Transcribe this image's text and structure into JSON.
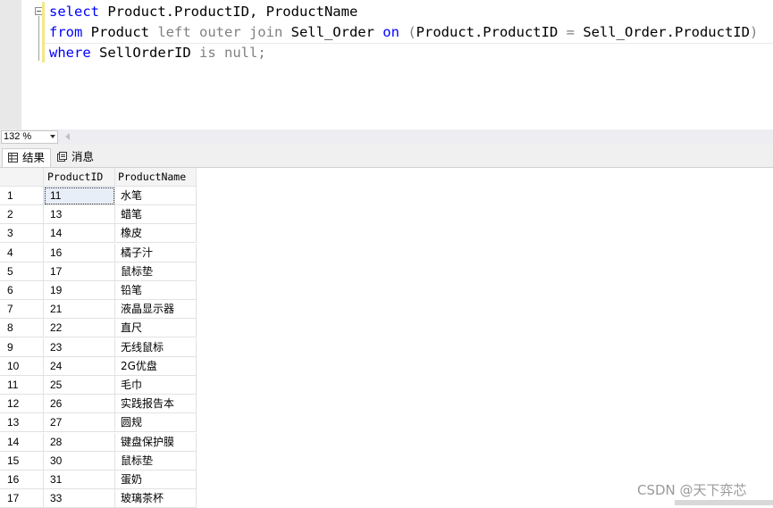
{
  "editor": {
    "line1": {
      "kw": "select",
      "text": " Product.ProductID, ProductName"
    },
    "line2": {
      "kw1": "from",
      "t1": " Product ",
      "g1": "left outer join",
      "t2": " Sell_Order ",
      "kw2": "on",
      "t3": " ",
      "g2": "(",
      "t4": "Product.ProductID ",
      "g3": "=",
      "t5": " Sell_Order.ProductID",
      "g4": ")"
    },
    "line3": {
      "kw": "where",
      "t1": " SellOrderID ",
      "g1": "is null;"
    }
  },
  "zoom": {
    "value": "132 %"
  },
  "tabs": [
    {
      "label": "结果",
      "icon": "grid-icon"
    },
    {
      "label": "消息",
      "icon": "message-icon"
    }
  ],
  "grid": {
    "columns": [
      "ProductID",
      "ProductName"
    ],
    "rows": [
      {
        "n": "1",
        "id": "11",
        "name": "水笔"
      },
      {
        "n": "2",
        "id": "13",
        "name": "蜡笔"
      },
      {
        "n": "3",
        "id": "14",
        "name": "橡皮"
      },
      {
        "n": "4",
        "id": "16",
        "name": "橘子汁"
      },
      {
        "n": "5",
        "id": "17",
        "name": "鼠标垫"
      },
      {
        "n": "6",
        "id": "19",
        "name": "铅笔"
      },
      {
        "n": "7",
        "id": "21",
        "name": "液晶显示器"
      },
      {
        "n": "8",
        "id": "22",
        "name": "直尺"
      },
      {
        "n": "9",
        "id": "23",
        "name": "无线鼠标"
      },
      {
        "n": "10",
        "id": "24",
        "name": "2G优盘"
      },
      {
        "n": "11",
        "id": "25",
        "name": "毛巾"
      },
      {
        "n": "12",
        "id": "26",
        "name": "实践报告本"
      },
      {
        "n": "13",
        "id": "27",
        "name": "圆规"
      },
      {
        "n": "14",
        "id": "28",
        "name": "键盘保护膜"
      },
      {
        "n": "15",
        "id": "30",
        "name": "鼠标垫"
      },
      {
        "n": "16",
        "id": "31",
        "name": "蛋奶"
      },
      {
        "n": "17",
        "id": "33",
        "name": "玻璃茶杯"
      }
    ]
  },
  "watermark": "CSDN @天下弈芯"
}
